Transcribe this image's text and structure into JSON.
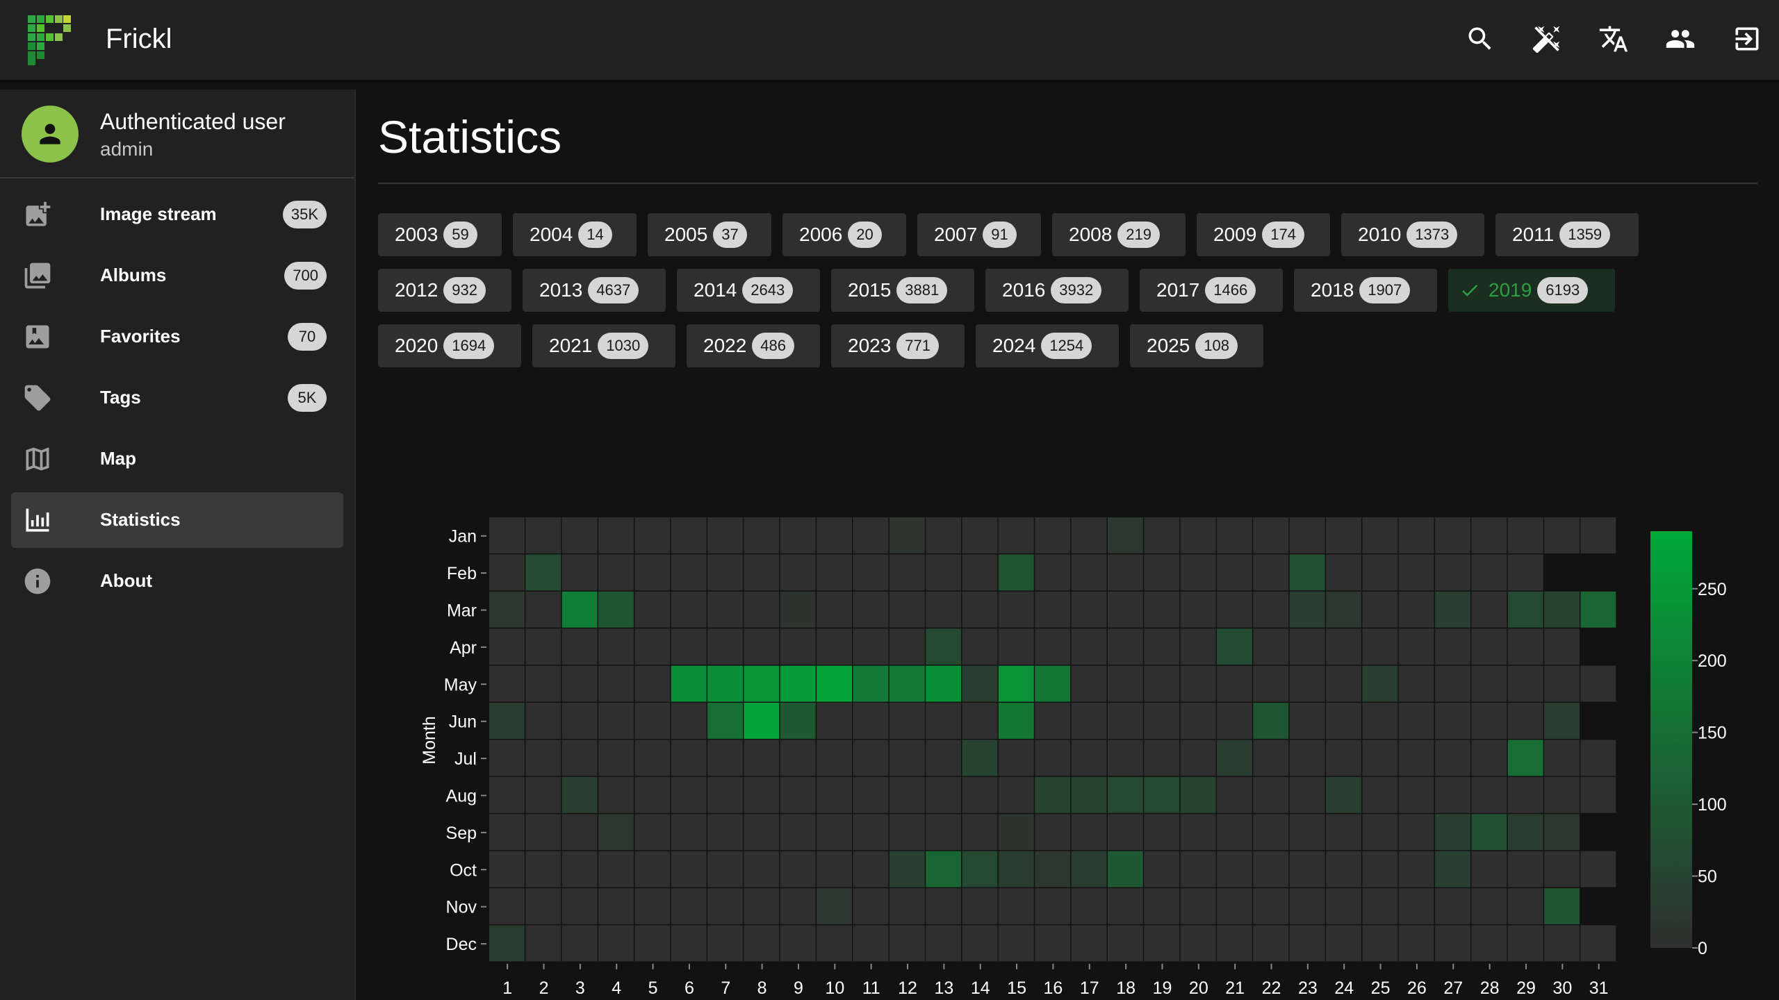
{
  "app": {
    "title": "Frickl"
  },
  "topbar": {
    "icons": [
      "search-icon",
      "magic-wand-icon",
      "translate-icon",
      "users-icon",
      "logout-icon"
    ]
  },
  "user": {
    "name": "Authenticated user",
    "role": "admin"
  },
  "nav": {
    "items": [
      {
        "label": "Image stream",
        "badge": "35K",
        "icon": "image-stream-icon"
      },
      {
        "label": "Albums",
        "badge": "700",
        "icon": "albums-icon"
      },
      {
        "label": "Favorites",
        "badge": "70",
        "icon": "favorites-icon"
      },
      {
        "label": "Tags",
        "badge": "5K",
        "icon": "tags-icon"
      },
      {
        "label": "Map",
        "badge": "",
        "icon": "map-icon"
      },
      {
        "label": "Statistics",
        "badge": "",
        "icon": "statistics-icon",
        "active": true
      },
      {
        "label": "About",
        "badge": "",
        "icon": "info-icon"
      }
    ]
  },
  "page": {
    "title": "Statistics"
  },
  "years": [
    {
      "year": "2003",
      "count": "59"
    },
    {
      "year": "2004",
      "count": "14"
    },
    {
      "year": "2005",
      "count": "37"
    },
    {
      "year": "2006",
      "count": "20"
    },
    {
      "year": "2007",
      "count": "91"
    },
    {
      "year": "2008",
      "count": "219"
    },
    {
      "year": "2009",
      "count": "174"
    },
    {
      "year": "2010",
      "count": "1373"
    },
    {
      "year": "2011",
      "count": "1359"
    },
    {
      "year": "2012",
      "count": "932"
    },
    {
      "year": "2013",
      "count": "4637"
    },
    {
      "year": "2014",
      "count": "2643"
    },
    {
      "year": "2015",
      "count": "3881"
    },
    {
      "year": "2016",
      "count": "3932"
    },
    {
      "year": "2017",
      "count": "1466"
    },
    {
      "year": "2018",
      "count": "1907"
    },
    {
      "year": "2019",
      "count": "6193",
      "selected": true
    },
    {
      "year": "2020",
      "count": "1694"
    },
    {
      "year": "2021",
      "count": "1030"
    },
    {
      "year": "2022",
      "count": "486"
    },
    {
      "year": "2023",
      "count": "771"
    },
    {
      "year": "2024",
      "count": "1254"
    },
    {
      "year": "2025",
      "count": "108"
    }
  ],
  "colors": {
    "accent": "#2e9e45",
    "cell_empty": "#2f2f2f",
    "cell_max": "#00a83a"
  },
  "chart_data": {
    "type": "heatmap",
    "title": "",
    "xlabel": "",
    "ylabel": "Month",
    "x": [
      1,
      2,
      3,
      4,
      5,
      6,
      7,
      8,
      9,
      10,
      11,
      12,
      13,
      14,
      15,
      16,
      17,
      18,
      19,
      20,
      21,
      22,
      23,
      24,
      25,
      26,
      27,
      28,
      29,
      30,
      31
    ],
    "y": [
      "Jan",
      "Feb",
      "Mar",
      "Apr",
      "May",
      "Jun",
      "Jul",
      "Aug",
      "Sep",
      "Oct",
      "Nov",
      "Dec"
    ],
    "days_in_month": [
      31,
      29,
      31,
      30,
      31,
      30,
      31,
      31,
      30,
      31,
      30,
      31
    ],
    "colorscale_ticks": [
      0,
      50,
      100,
      150,
      200,
      250
    ],
    "zmin": 0,
    "zmax": 290,
    "values": [
      [
        0,
        0,
        0,
        0,
        0,
        0,
        0,
        0,
        0,
        0,
        0,
        15,
        0,
        0,
        0,
        0,
        0,
        20,
        0,
        0,
        0,
        0,
        0,
        0,
        0,
        0,
        0,
        0,
        0,
        0,
        0
      ],
      [
        0,
        70,
        0,
        0,
        0,
        0,
        0,
        0,
        0,
        0,
        0,
        0,
        0,
        0,
        90,
        0,
        0,
        0,
        0,
        0,
        0,
        0,
        80,
        0,
        0,
        0,
        0,
        0,
        0
      ],
      [
        20,
        0,
        190,
        90,
        0,
        0,
        0,
        0,
        10,
        0,
        0,
        0,
        0,
        0,
        0,
        0,
        0,
        0,
        0,
        0,
        0,
        0,
        40,
        20,
        0,
        0,
        40,
        0,
        60,
        50,
        130
      ],
      [
        0,
        0,
        0,
        0,
        0,
        0,
        0,
        0,
        0,
        0,
        0,
        0,
        60,
        0,
        0,
        0,
        0,
        0,
        0,
        0,
        70,
        0,
        0,
        0,
        0,
        0,
        0,
        0,
        0,
        0
      ],
      [
        0,
        0,
        0,
        0,
        0,
        230,
        230,
        240,
        260,
        280,
        180,
        180,
        230,
        40,
        240,
        170,
        0,
        0,
        0,
        0,
        0,
        0,
        0,
        0,
        40,
        0,
        0,
        0,
        0,
        0,
        0
      ],
      [
        30,
        0,
        0,
        0,
        0,
        0,
        150,
        280,
        100,
        0,
        0,
        0,
        0,
        0,
        170,
        0,
        0,
        0,
        0,
        0,
        0,
        90,
        0,
        0,
        0,
        0,
        0,
        0,
        0,
        40
      ],
      [
        0,
        0,
        0,
        0,
        0,
        0,
        0,
        0,
        0,
        0,
        0,
        0,
        0,
        50,
        0,
        0,
        0,
        0,
        0,
        0,
        30,
        0,
        0,
        0,
        0,
        0,
        0,
        0,
        150,
        0,
        0
      ],
      [
        0,
        0,
        40,
        0,
        0,
        0,
        0,
        0,
        0,
        0,
        0,
        0,
        0,
        0,
        0,
        50,
        50,
        60,
        60,
        50,
        0,
        0,
        0,
        40,
        0,
        0,
        0,
        0,
        0,
        0,
        0
      ],
      [
        0,
        0,
        0,
        20,
        0,
        0,
        0,
        0,
        0,
        0,
        0,
        0,
        0,
        0,
        10,
        0,
        0,
        0,
        0,
        0,
        0,
        0,
        0,
        0,
        0,
        0,
        40,
        80,
        30,
        20
      ],
      [
        0,
        0,
        0,
        0,
        0,
        0,
        0,
        0,
        0,
        0,
        0,
        40,
        130,
        60,
        30,
        20,
        30,
        100,
        0,
        0,
        0,
        0,
        0,
        0,
        0,
        0,
        40,
        0,
        0,
        0,
        0
      ],
      [
        0,
        0,
        0,
        0,
        0,
        0,
        0,
        0,
        0,
        20,
        0,
        0,
        0,
        0,
        0,
        0,
        0,
        0,
        0,
        0,
        0,
        0,
        0,
        0,
        0,
        0,
        0,
        0,
        0,
        90
      ],
      [
        30,
        0,
        0,
        0,
        0,
        0,
        0,
        0,
        0,
        0,
        0,
        0,
        0,
        0,
        0,
        0,
        0,
        0,
        0,
        0,
        0,
        0,
        0,
        0,
        0,
        0,
        0,
        0,
        0,
        0,
        0
      ]
    ],
    "grid": false,
    "legend": "colorbar-right"
  }
}
